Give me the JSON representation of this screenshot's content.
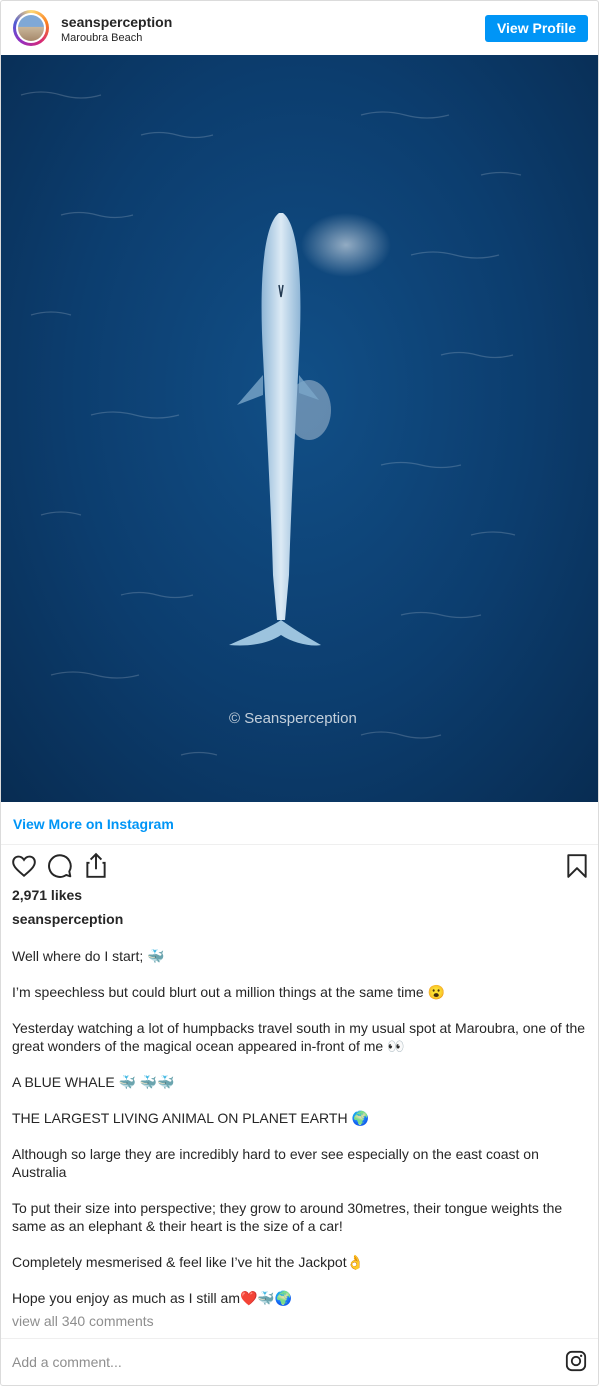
{
  "post": {
    "username": "seansperception",
    "location": "Maroubra Beach",
    "view_profile_label": "View Profile",
    "watermark": "© Seansperception",
    "view_more_label": "View More on Instagram",
    "likes": "2,971 likes",
    "caption_username": "seansperception",
    "caption_paragraphs": [
      "Well where do I start; 🐳",
      "I’m speechless but could blurt out a million things at the same time 😮",
      "Yesterday watching a lot of humpbacks travel south in my usual spot at Maroubra, one of the great wonders of the magical ocean appeared in-front of me 👀",
      "A BLUE WHALE 🐳 🐳🐳",
      "THE LARGEST LIVING ANIMAL ON PLANET EARTH 🌍",
      "Although so large they are incredibly hard to ever see especially on the east coast on Australia",
      "To put their size into perspective; they grow to around 30metres, their tongue weights the same as an elephant & their heart is the size of a car!",
      "Completely mesmerised & feel like I’ve hit the Jackpot👌",
      "Hope you enjoy as much as I still am❤️🐳🌍"
    ],
    "view_comments": "view all 340 comments",
    "comment_placeholder": "Add a comment..."
  },
  "icons": {
    "like": "heart-icon",
    "comment": "comment-icon",
    "share": "share-icon",
    "save": "bookmark-icon",
    "brand": "instagram-icon"
  },
  "colors": {
    "accent": "#0095f6",
    "ocean": "#0c3d6e",
    "muted_text": "#8e8e8e"
  }
}
